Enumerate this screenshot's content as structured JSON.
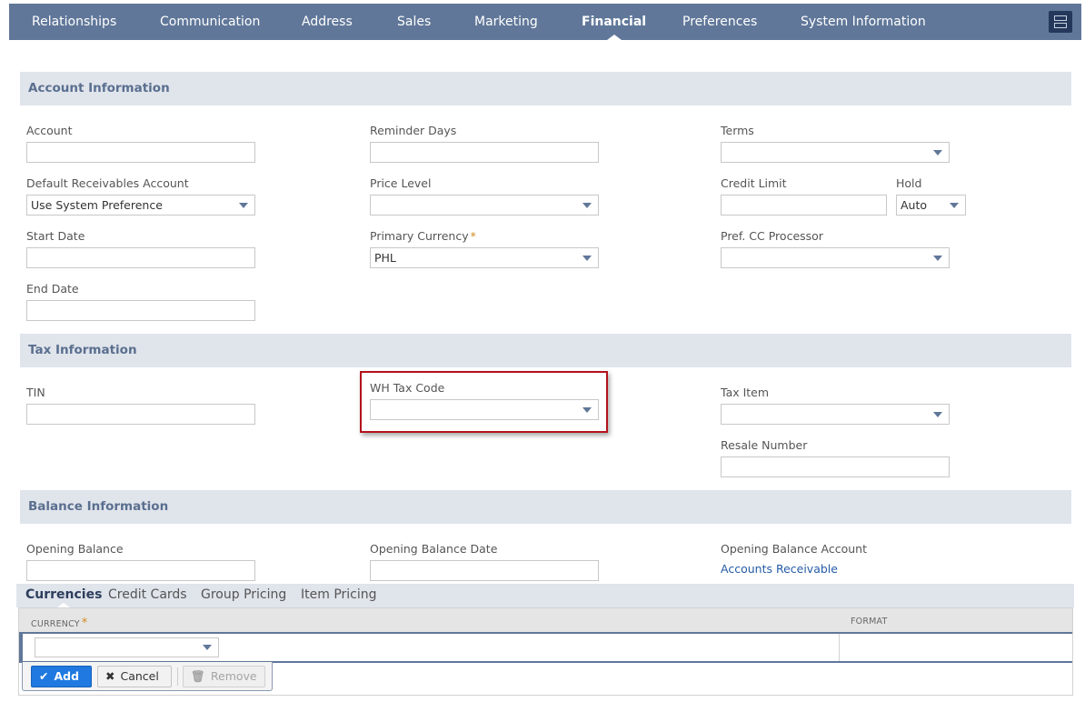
{
  "tabs": [
    {
      "label": "Relationships",
      "active": false
    },
    {
      "label": "Communication",
      "active": false
    },
    {
      "label": "Address",
      "active": false
    },
    {
      "label": "Sales",
      "active": false
    },
    {
      "label": "Marketing",
      "active": false
    },
    {
      "label": "Financial",
      "active": true
    },
    {
      "label": "Preferences",
      "active": false
    },
    {
      "label": "System Information",
      "active": false
    }
  ],
  "layout_toggle_icon": "layout-rows-icon",
  "sections": {
    "account": {
      "title": "Account Information",
      "fields": {
        "account": {
          "label": "Account",
          "value": ""
        },
        "default_receivables_account": {
          "label": "Default Receivables Account",
          "value": "Use System Preference"
        },
        "start_date": {
          "label": "Start Date",
          "value": ""
        },
        "end_date": {
          "label": "End Date",
          "value": ""
        },
        "reminder_days": {
          "label": "Reminder Days",
          "value": ""
        },
        "price_level": {
          "label": "Price Level",
          "value": ""
        },
        "primary_currency": {
          "label": "Primary Currency",
          "required_mark": "*",
          "value": "PHL"
        },
        "terms": {
          "label": "Terms",
          "value": ""
        },
        "credit_limit": {
          "label": "Credit Limit",
          "value": ""
        },
        "hold": {
          "label": "Hold",
          "value": "Auto"
        },
        "pref_cc_processor": {
          "label": "Pref. CC Processor",
          "value": ""
        }
      }
    },
    "tax": {
      "title": "Tax Information",
      "fields": {
        "tin": {
          "label": "TIN",
          "value": ""
        },
        "wh_tax_code": {
          "label": "WH Tax Code",
          "value": ""
        },
        "tax_item": {
          "label": "Tax Item",
          "value": ""
        },
        "resale_number": {
          "label": "Resale Number",
          "value": ""
        }
      }
    },
    "balance": {
      "title": "Balance Information",
      "fields": {
        "opening_balance": {
          "label": "Opening Balance",
          "value": ""
        },
        "opening_balance_date": {
          "label": "Opening Balance Date",
          "value": ""
        },
        "opening_balance_account": {
          "label": "Opening Balance Account",
          "value": "Accounts Receivable"
        }
      }
    }
  },
  "sublist": {
    "tabs": [
      {
        "label": "Currencies",
        "active": true
      },
      {
        "label": "Credit Cards",
        "active": false
      },
      {
        "label": "Group Pricing",
        "active": false
      },
      {
        "label": "Item Pricing",
        "active": false
      }
    ],
    "columns": [
      {
        "label": "CURRENCY",
        "required_mark": "*"
      },
      {
        "label": "FORMAT"
      }
    ],
    "row": {
      "currency": "",
      "format": ""
    },
    "buttons": {
      "add": {
        "label": "Add",
        "icon": "checkmark-icon"
      },
      "cancel": {
        "label": "Cancel",
        "icon": "x-icon"
      },
      "remove": {
        "label": "Remove",
        "icon": "trash-icon"
      }
    }
  },
  "colors": {
    "tabbar": "#607799",
    "section_bg": "#e0e4eb",
    "section_title": "#5a6f8f",
    "required": "#d48a1e",
    "link": "#255ba6",
    "highlight_border": "#b3121b",
    "add_button": "#1f79e0"
  }
}
